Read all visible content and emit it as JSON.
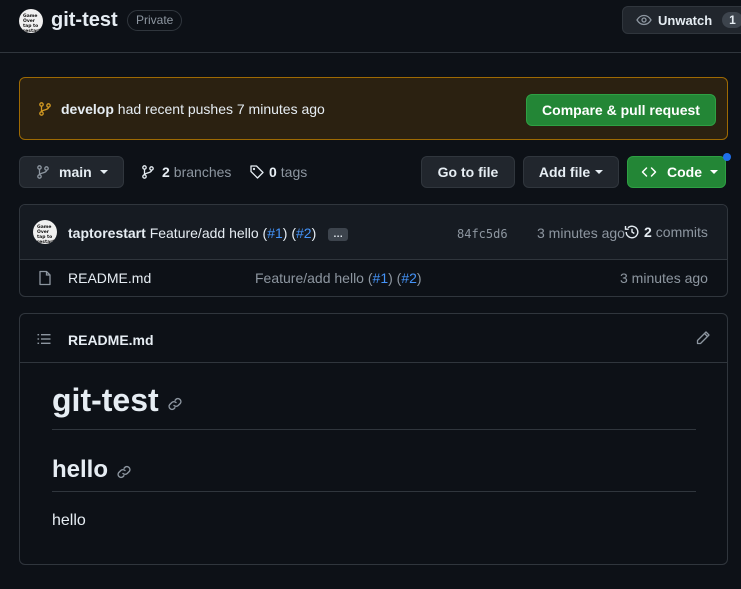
{
  "header": {
    "owner_avatar_text": "Game Over tap to restart",
    "repo_name": "git-test",
    "visibility": "Private",
    "watch_label": "Unwatch",
    "watch_count": "1"
  },
  "banner": {
    "branch": "develop",
    "message": "had recent pushes 7 minutes ago",
    "button_label": "Compare & pull request"
  },
  "toolbar": {
    "current_branch": "main",
    "branches_count": "2",
    "branches_label": "branches",
    "tags_count": "0",
    "tags_label": "tags",
    "go_to_file_label": "Go to file",
    "add_file_label": "Add file",
    "code_label": "Code"
  },
  "latest_commit": {
    "author": "taptorestart",
    "message_prefix": "Feature/add hello (",
    "ref1": "#1",
    "message_mid": ") (",
    "ref2": "#2",
    "message_suffix": ")",
    "ellipsis": "…",
    "sha": "84fc5d6",
    "time": "3 minutes ago",
    "commits_count": "2",
    "commits_label": "commits"
  },
  "files": [
    {
      "name": "README.md",
      "commit_prefix": "Feature/add hello (",
      "ref1": "#1",
      "commit_mid": ") (",
      "ref2": "#2",
      "commit_suffix": ")",
      "time": "3 minutes ago"
    }
  ],
  "readme": {
    "filename": "README.md",
    "h1": "git-test",
    "h2": "hello",
    "paragraph": "hello"
  },
  "colors": {
    "accent_link": "#4493f8",
    "primary_button": "#238636",
    "banner_border": "#9e6a03"
  }
}
